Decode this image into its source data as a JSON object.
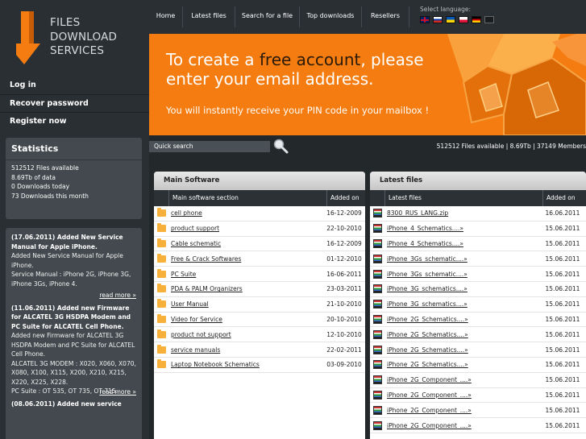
{
  "logo": {
    "line1": "FILES",
    "line2": "DOWNLOAD",
    "line3": "SERVICES"
  },
  "nav": [
    "Home",
    "Latest files",
    "Search for a file",
    "Top downloads",
    "Resellers"
  ],
  "language": {
    "label": "Select language:",
    "flags": [
      "uk-flag-icon",
      "ru-flag-icon",
      "ua-flag-icon",
      "pl-flag-icon",
      "de-flag-icon",
      "blank-flag-icon"
    ]
  },
  "side_menu": [
    "Log in",
    "Recover password",
    "Register now"
  ],
  "stats": {
    "title": "Statistics",
    "lines": [
      "512512 Files available",
      "8.69Tb of data",
      "0 Downloads today",
      "73 Downloads this month"
    ]
  },
  "news": [
    {
      "title": "(17.06.2011) Added New Service Manual for Apple iPhone.",
      "body": "Added New Service Manual for Apple iPhone.\nService Manual : iPhone 2G, iPhone 3G, iPhone 3Gs, iPhone 4.",
      "more": "read more »"
    },
    {
      "title": "(11.06.2011) Added new Firmware for ALCATEL 3G HSDPA Modem and PC Suite for ALCATEL Cell Phone.",
      "body": "Added new Firmware for ALCATEL 3G HSDPA Modem and PC Suite for ALCATEL Cell Phone.\nALCATEL 3G MODEM : X020, X060, X070, X080, X100, X115, X200, X210, X215, X220, X225, X228.\nPC Suite : OT 535, OT 735, OT 715.",
      "more": "read more »"
    },
    {
      "title": "(08.06.2011) Added new service",
      "body": "",
      "more": ""
    }
  ],
  "banner": {
    "line1_pre": "To create a ",
    "line1_em": "free account",
    "line1_post": ", please",
    "line2": "enter your email address.",
    "line3": "You will instantly receive your PIN code in your mailbox !"
  },
  "search": {
    "placeholder": "Quick search"
  },
  "site_stats": "512512 Files available | 8.69Tb | 37149 Members",
  "main_software": {
    "title": "Main Software",
    "col1": "Main software section",
    "col2": "Added on",
    "rows": [
      {
        "name": "cell phone",
        "date": "16-12-2009"
      },
      {
        "name": "product  support",
        "date": "22-10-2010"
      },
      {
        "name": "Cable  schematic",
        "date": "16-12-2009"
      },
      {
        "name": "Free & Crack Softwares",
        "date": "01-12-2010"
      },
      {
        "name": "PC Suite",
        "date": "16-06-2011"
      },
      {
        "name": "PDA & PALM Organizers",
        "date": "23-03-2011"
      },
      {
        "name": "User  Manual",
        "date": "21-10-2010"
      },
      {
        "name": "Video  for  Service",
        "date": "20-10-2010"
      },
      {
        "name": "product not support",
        "date": "12-10-2010"
      },
      {
        "name": "service  manuals",
        "date": "22-02-2011"
      },
      {
        "name": "Laptop Notebook Schematics",
        "date": "03-09-2010"
      }
    ]
  },
  "latest_files": {
    "title": "Latest files",
    "col1": "Latest files",
    "col2": "Added on",
    "rows": [
      {
        "name": "8300_RUS_LANG.zip",
        "date": "16.06.2011"
      },
      {
        "name": "iPhone_4_Schematics....»",
        "date": "15.06.2011"
      },
      {
        "name": "iPhone_4_Schematics....»",
        "date": "15.06.2011"
      },
      {
        "name": "iPhone_3Gs_schematic....»",
        "date": "15.06.2011"
      },
      {
        "name": "iPhone_3Gs_schematic....»",
        "date": "15.06.2011"
      },
      {
        "name": "iPhone_3G_schematics....»",
        "date": "15.06.2011"
      },
      {
        "name": "iPhone_3G_schematics....»",
        "date": "15.06.2011"
      },
      {
        "name": "iPhone_2G_Schematics....»",
        "date": "15.06.2011"
      },
      {
        "name": "iPhone_2G_Schematics....»",
        "date": "15.06.2011"
      },
      {
        "name": "iPhone_2G_Schematics....»",
        "date": "15.06.2011"
      },
      {
        "name": "iPhone_2G_Schematics....»",
        "date": "15.06.2011"
      },
      {
        "name": "iPhone_2G_Component_....»",
        "date": "15.06.2011"
      },
      {
        "name": "iPhone_2G_Component_....»",
        "date": "15.06.2011"
      },
      {
        "name": "iPhone_2G_Component_....»",
        "date": "15.06.2011"
      },
      {
        "name": "iPhone_2G_Component_....»",
        "date": "15.06.2011"
      }
    ]
  },
  "colors": {
    "accent": "#f47c10",
    "dark": "#23282b",
    "panel": "#43494e"
  }
}
